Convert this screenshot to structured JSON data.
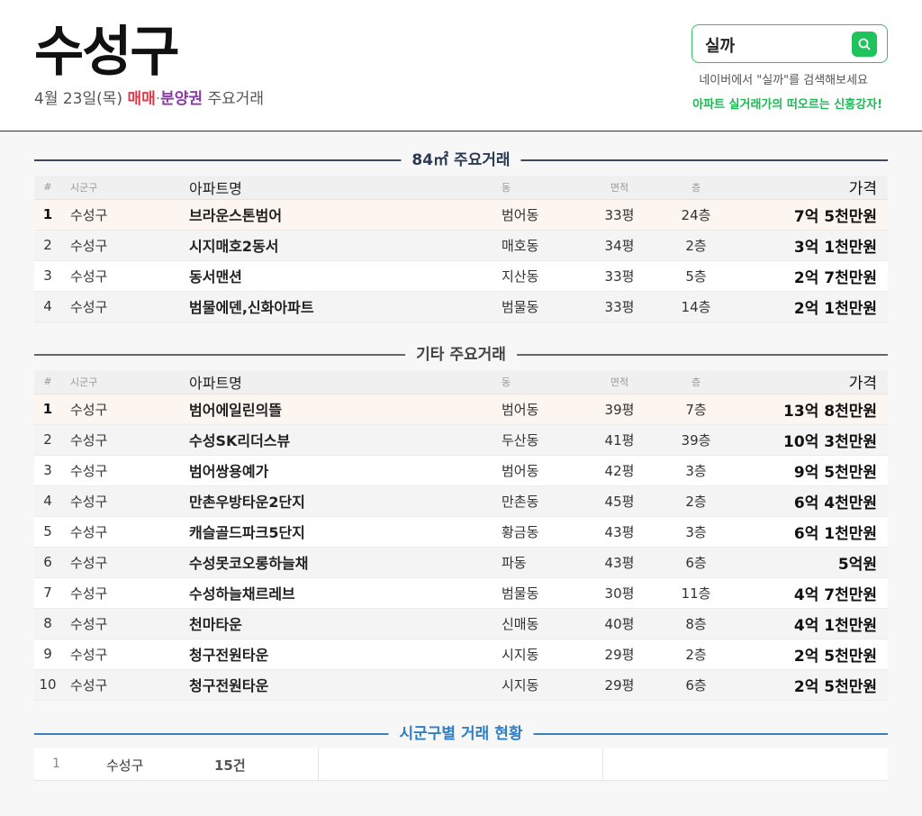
{
  "header": {
    "title": "수성구",
    "date": "4월 23일(목)",
    "type_sale": "매매",
    "separator": "·",
    "type_presale": "분양권",
    "suffix": "주요거래"
  },
  "search": {
    "query": "실까",
    "hint": "네이버에서 \"실까\"를 검색해보세요",
    "tagline": "아파트 실거래가의 떠오르는 신흥강자!",
    "icon": "search-icon"
  },
  "columns": {
    "rank": "#",
    "gu": "시군구",
    "apt": "아파트명",
    "dong": "동",
    "area": "면적",
    "floor": "층",
    "price": "가격"
  },
  "section1": {
    "title": "84㎡ 주요거래",
    "rows": [
      {
        "rank": "1",
        "gu": "수성구",
        "apt": "브라운스톤범어",
        "dong": "범어동",
        "area": "33평",
        "floor": "24층",
        "price": "7억 5천만원"
      },
      {
        "rank": "2",
        "gu": "수성구",
        "apt": "시지매호2동서",
        "dong": "매호동",
        "area": "34평",
        "floor": "2층",
        "price": "3억 1천만원"
      },
      {
        "rank": "3",
        "gu": "수성구",
        "apt": "동서맨션",
        "dong": "지산동",
        "area": "33평",
        "floor": "5층",
        "price": "2억 7천만원"
      },
      {
        "rank": "4",
        "gu": "수성구",
        "apt": "범물에덴,신화아파트",
        "dong": "범물동",
        "area": "33평",
        "floor": "14층",
        "price": "2억 1천만원"
      }
    ]
  },
  "section2": {
    "title": "기타 주요거래",
    "rows": [
      {
        "rank": "1",
        "gu": "수성구",
        "apt": "범어에일린의뜰",
        "dong": "범어동",
        "area": "39평",
        "floor": "7층",
        "price": "13억 8천만원"
      },
      {
        "rank": "2",
        "gu": "수성구",
        "apt": "수성SK리더스뷰",
        "dong": "두산동",
        "area": "41평",
        "floor": "39층",
        "price": "10억 3천만원"
      },
      {
        "rank": "3",
        "gu": "수성구",
        "apt": "범어쌍용예가",
        "dong": "범어동",
        "area": "42평",
        "floor": "3층",
        "price": "9억 5천만원"
      },
      {
        "rank": "4",
        "gu": "수성구",
        "apt": "만촌우방타운2단지",
        "dong": "만촌동",
        "area": "45평",
        "floor": "2층",
        "price": "6억 4천만원"
      },
      {
        "rank": "5",
        "gu": "수성구",
        "apt": "캐슬골드파크5단지",
        "dong": "황금동",
        "area": "43평",
        "floor": "3층",
        "price": "6억 1천만원"
      },
      {
        "rank": "6",
        "gu": "수성구",
        "apt": "수성못코오롱하늘채",
        "dong": "파동",
        "area": "43평",
        "floor": "6층",
        "price": "5억원"
      },
      {
        "rank": "7",
        "gu": "수성구",
        "apt": "수성하늘채르레브",
        "dong": "범물동",
        "area": "30평",
        "floor": "11층",
        "price": "4억 7천만원"
      },
      {
        "rank": "8",
        "gu": "수성구",
        "apt": "천마타운",
        "dong": "신매동",
        "area": "40평",
        "floor": "8층",
        "price": "4억 1천만원"
      },
      {
        "rank": "9",
        "gu": "수성구",
        "apt": "청구전원타운",
        "dong": "시지동",
        "area": "29평",
        "floor": "2층",
        "price": "2억 5천만원"
      },
      {
        "rank": "10",
        "gu": "수성구",
        "apt": "청구전원타운",
        "dong": "시지동",
        "area": "29평",
        "floor": "6층",
        "price": "2억 5천만원"
      }
    ]
  },
  "section3": {
    "title": "시군구별 거래 현황",
    "rows": [
      {
        "rank": "1",
        "gu": "수성구",
        "count": "15건"
      }
    ]
  }
}
